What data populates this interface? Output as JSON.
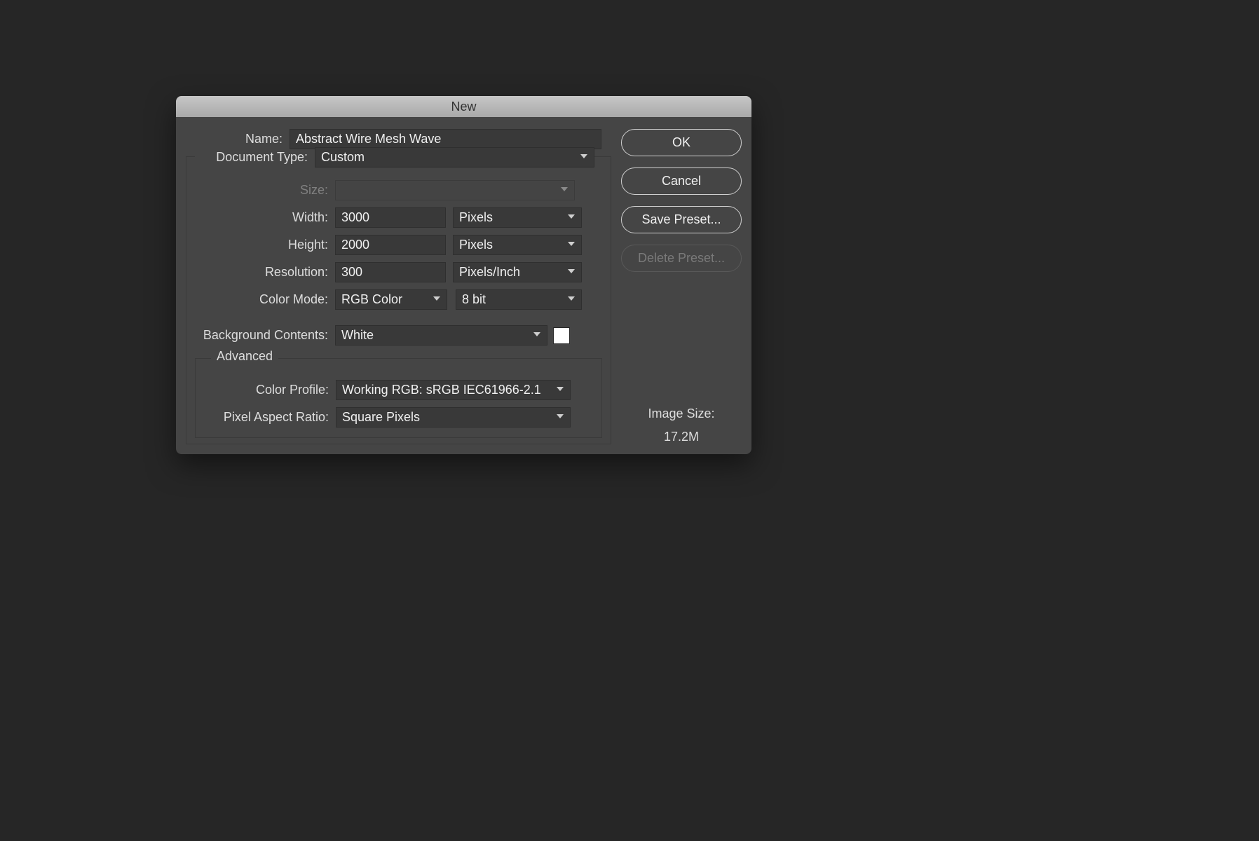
{
  "dialog": {
    "title": "New",
    "labels": {
      "name": "Name:",
      "doctype": "Document Type:",
      "size": "Size:",
      "width": "Width:",
      "height": "Height:",
      "resolution": "Resolution:",
      "colorMode": "Color Mode:",
      "bgContents": "Background Contents:",
      "advanced": "Advanced",
      "colorProfile": "Color Profile:",
      "pixelAspect": "Pixel Aspect Ratio:"
    },
    "values": {
      "name": "Abstract Wire Mesh Wave",
      "doctype": "Custom",
      "size": "",
      "width": "3000",
      "widthUnit": "Pixels",
      "height": "2000",
      "heightUnit": "Pixels",
      "resolution": "300",
      "resolutionUnit": "Pixels/Inch",
      "colorMode": "RGB Color",
      "bitDepth": "8 bit",
      "bgContents": "White",
      "bgSwatch": "#ffffff",
      "colorProfile": "Working RGB:  sRGB IEC61966-2.1",
      "pixelAspect": "Square Pixels"
    },
    "buttons": {
      "ok": "OK",
      "cancel": "Cancel",
      "savePreset": "Save Preset...",
      "deletePreset": "Delete Preset..."
    },
    "info": {
      "imageSizeLabel": "Image Size:",
      "imageSizeValue": "17.2M"
    }
  }
}
